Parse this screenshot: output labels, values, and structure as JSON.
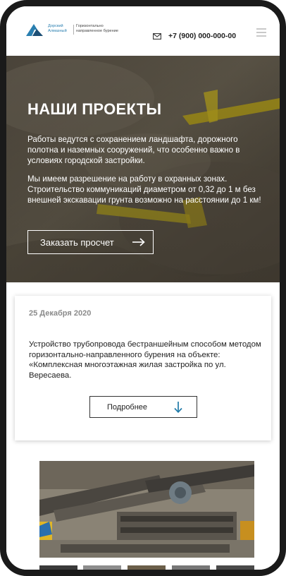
{
  "header": {
    "logo_name": "Дорский Алмазный",
    "logo_tagline": "Горизонтально направленное бурение",
    "phone": "+7 (900) 000-000-00",
    "mail_icon": "mail-icon",
    "menu_icon": "hamburger-menu-icon"
  },
  "hero": {
    "title": "НАШИ ПРОЕКТЫ",
    "paragraph_1": "Работы ведутся с сохранением ландшафта, дорожного полотна и наземных сооружений, что особенно важно в условиях городской застройки.",
    "paragraph_2": "Мы имеем разрешение на работу в охранных зонах. Строительство коммуникаций диаметром от 0,32 до 1 м без внешней экскавации грунта возможно на расстоянии до 1 км!",
    "button_label": "Заказать просчет",
    "button_icon": "arrow-right-icon"
  },
  "news": {
    "date": "25 Декабря 2020",
    "text": "Устройство трубопровода бестраншейным способом методом горизонтально-направленного бурения на объекте: «Комплексная многоэтажная жилая застройка по ул. Вересаева.",
    "button_label": "Подробнее",
    "button_icon": "arrow-down-icon"
  },
  "colors": {
    "accent": "#1f7aa8",
    "text": "#222222",
    "date": "#8a8a8a"
  }
}
